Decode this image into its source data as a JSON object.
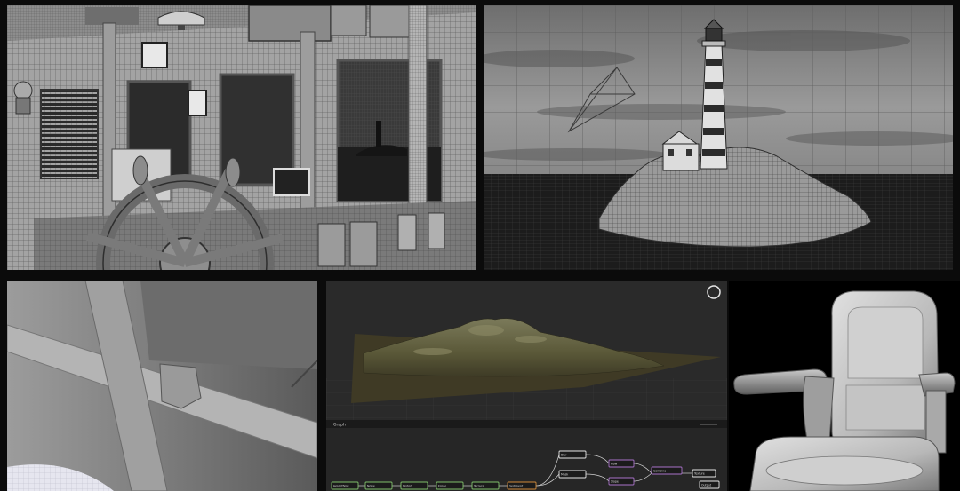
{
  "panels": {
    "bridge": {
      "name": "wheelhouse-wireframe-render"
    },
    "lighthouse": {
      "name": "lighthouse-island-wireframe-render"
    },
    "closeup": {
      "name": "ceiling-beam-clay-render"
    },
    "editor": {
      "name": "terrain-node-editor",
      "graph_tab_label": "Graph",
      "nodes": [
        {
          "id": "n1",
          "label": "Heightfield"
        },
        {
          "id": "n2",
          "label": "Noise"
        },
        {
          "id": "n3",
          "label": "Distort"
        },
        {
          "id": "n4",
          "label": "Erode"
        },
        {
          "id": "n5",
          "label": "Terrace"
        },
        {
          "id": "n6",
          "label": "Sediment"
        },
        {
          "id": "n7",
          "label": "Blur"
        },
        {
          "id": "n8",
          "label": "Mask"
        },
        {
          "id": "n9",
          "label": "Flow"
        },
        {
          "id": "n10",
          "label": "Slope"
        },
        {
          "id": "n11",
          "label": "Combine"
        },
        {
          "id": "n12",
          "label": "Texture"
        },
        {
          "id": "n13",
          "label": "Output"
        }
      ]
    },
    "chair": {
      "name": "captain-chair-clay-render"
    }
  },
  "colors": {
    "background": "#0b0b0b",
    "editor_bg": "#1f1f1f",
    "node_green": "#7fbf6a",
    "node_orange": "#d08a3a",
    "node_purple": "#a872c8",
    "node_white": "#e6e6e6"
  },
  "icons": {
    "viewport_nav": "circle-icon"
  }
}
